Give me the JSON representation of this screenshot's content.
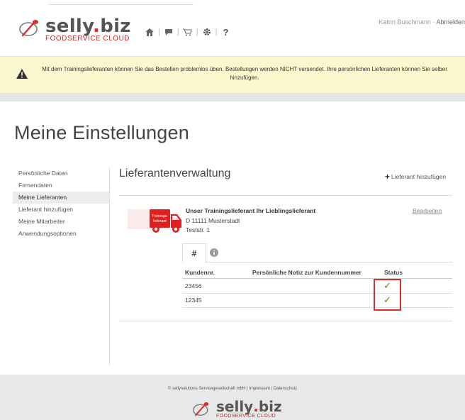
{
  "header": {
    "brand_prefix": "selly",
    "brand_dot": ".",
    "brand_suffix": "biz",
    "tagline": "FOODSERVICE CLOUD",
    "nav_icons": [
      "home-icon",
      "chat-icon",
      "cart-icon",
      "gear-icon",
      "help-icon"
    ],
    "help_label": "?",
    "user_name": "Katrin Buschmann",
    "separator": "·",
    "logout_label": "Abmelden"
  },
  "banner": {
    "icon": "warning-icon",
    "text": "Mit dem Trainingslieferanten können Sie das Bestellen problemlos üben. Bestellungen werden NICHT versendet. Ihre persönlichen Lieferanten können Sie selber hinzufügen."
  },
  "page": {
    "title": "Meine Einstellungen"
  },
  "sidebar": {
    "items": [
      {
        "label": "Persönliche Daten"
      },
      {
        "label": "Firmendaten"
      },
      {
        "label": "Meine Lieferanten"
      },
      {
        "label": "Lieferant hinzufügen"
      },
      {
        "label": "Meine Mitarbeiter"
      },
      {
        "label": "Anwendungsoptionen"
      }
    ],
    "active_index": 2
  },
  "main": {
    "section_title": "Lieferantenverwaltung",
    "add_supplier_label": "Lieferant hinzufügen",
    "supplier": {
      "truck_label_line1": "Trainings-",
      "truck_label_line2": "lieferant",
      "name": "Unser Trainingslieferant Ihr Lieblingslieferant",
      "city": "D 11111 Musterstadt",
      "street": "Teststr. 1",
      "edit_label": "Bearbeiten"
    },
    "tabs": [
      {
        "label": "#",
        "active": true
      },
      {
        "icon": "info-icon",
        "active": false
      }
    ],
    "table": {
      "headers": [
        "Kundennr.",
        "Persönliche Notiz zur Kundennummer",
        "Status"
      ],
      "rows": [
        {
          "customer_no": "23456",
          "note": "",
          "status": "✓"
        },
        {
          "customer_no": "12345",
          "note": "",
          "status": "✓"
        }
      ]
    }
  },
  "footer": {
    "copyright": "© sellysolutions Servicegesellschaft mbH | Impressum | Datenschutz",
    "brand_prefix": "selly",
    "brand_dot": ".",
    "brand_suffix": "biz",
    "tagline": "FOODSERVICE CLOUD"
  },
  "colors": {
    "brand_red": "#d32f2f",
    "banner_bg": "#fbf8cf",
    "status_green": "#4a8a1c"
  }
}
